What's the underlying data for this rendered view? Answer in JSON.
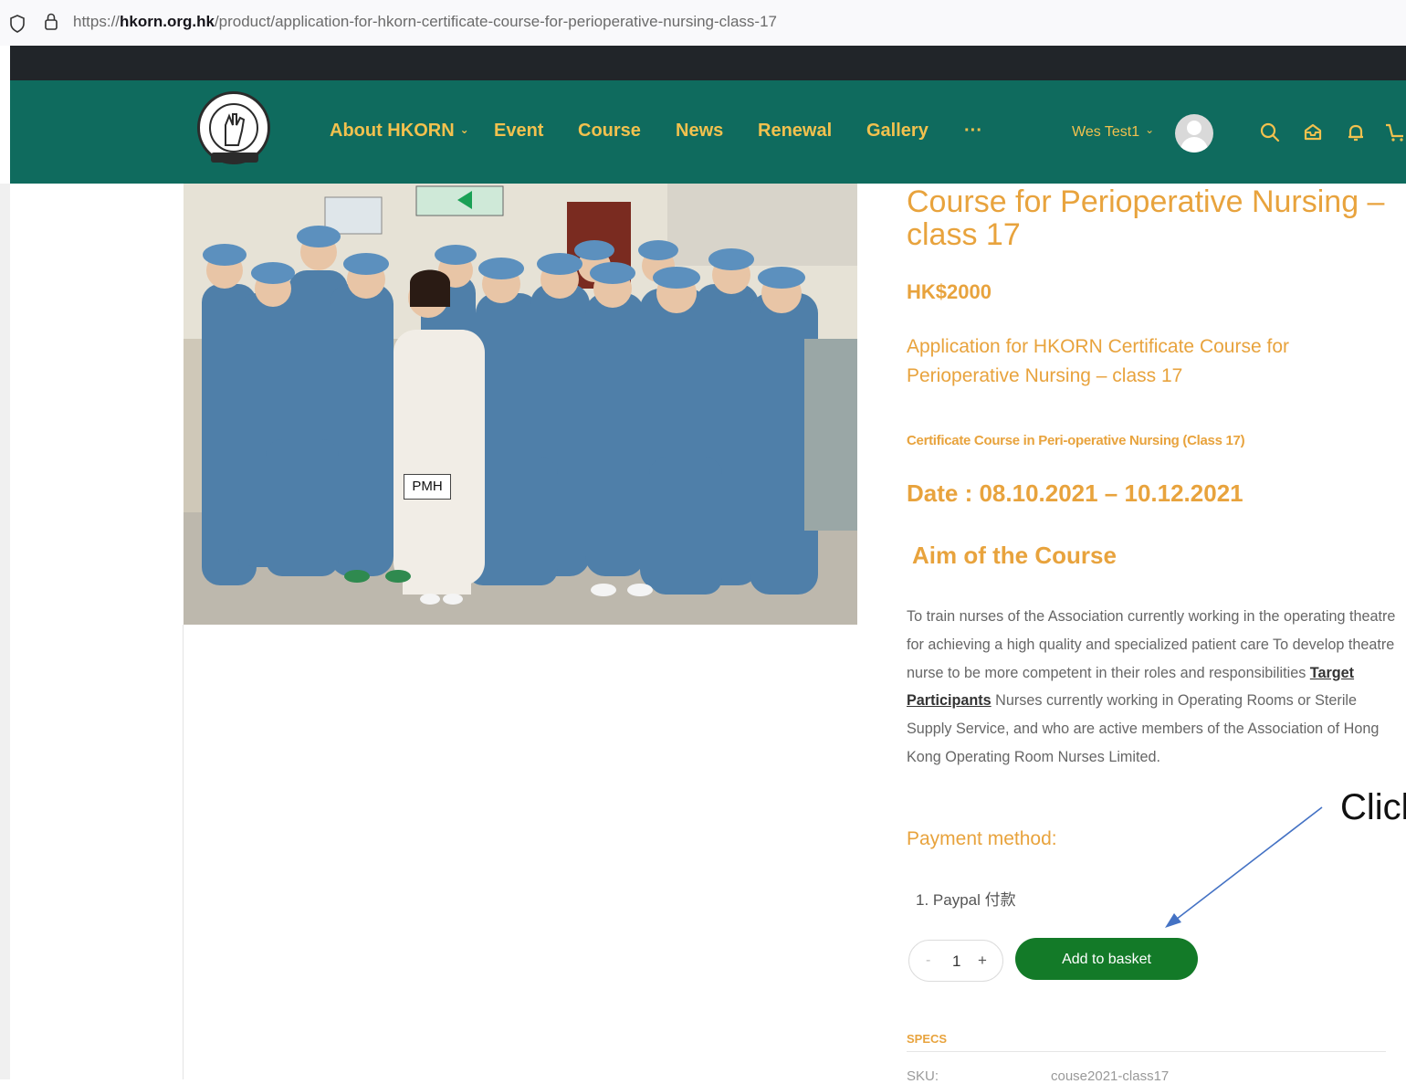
{
  "browser": {
    "url_prefix": "https://",
    "url_domain": "hkorn.org.hk",
    "url_path": "/product/application-for-hkorn-certificate-course-for-perioperative-nursing-class-17"
  },
  "nav": {
    "items": [
      "About HKORN",
      "Event",
      "Course",
      "News",
      "Renewal",
      "Gallery",
      "···"
    ],
    "user": "Wes Test1"
  },
  "photo": {
    "label": "PMH"
  },
  "product": {
    "title": "Course for Perioperative Nursing – class 17",
    "price": "HK$2000",
    "short_desc": "Application for HKORN Certificate Course for Perioperative Nursing – class 17",
    "cert_heading": "Certificate Course in Peri-operative Nursing (Class 17)",
    "date": "Date : 08.10.2021 – 10.12.2021",
    "aim_heading": "Aim of the Course",
    "desc_part1": "To train nurses of the Association currently working in the operating theatre for achieving a high quality and specialized patient care   To develop theatre nurse to be more competent in their roles and responsibilities  ",
    "desc_link": "Target Participants",
    "desc_part2": "  Nurses currently working in Operating Rooms or Sterile Supply Service, and who are active members of the Association of Hong Kong Operating Room Nurses Limited.",
    "payment_label": "Payment method:",
    "payment_item": "1.  Paypal 付款",
    "qty_minus": "-",
    "qty_value": "1",
    "qty_plus": "+",
    "add_button": "Add to basket",
    "specs_label": "SPECS",
    "sku_label": "SKU:",
    "sku_value": "couse2021-class17"
  },
  "annotation": {
    "text": "Click"
  },
  "colors": {
    "header_bg": "#0f6b5e",
    "nav_text": "#f2c14e",
    "accent_orange": "#e8a33d",
    "button_green": "#137a28"
  }
}
